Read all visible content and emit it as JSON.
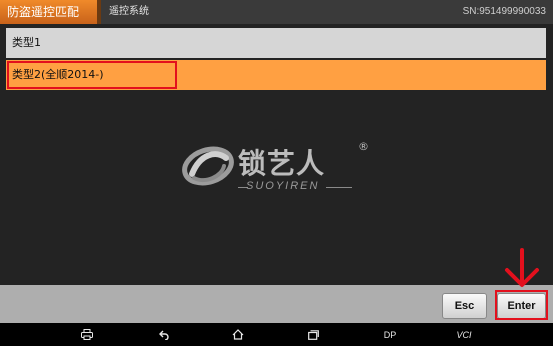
{
  "header": {
    "title": "防盗遥控匹配",
    "subtitle": "遥控系统",
    "serial": "SN:951499990033"
  },
  "list": {
    "items": [
      {
        "label": "类型1",
        "selected": false
      },
      {
        "label": "类型2(全顺2014-)",
        "selected": true
      }
    ]
  },
  "watermark": {
    "brand": "锁艺人",
    "registered": "®",
    "subtext": "SUOYIREN"
  },
  "footer": {
    "esc_label": "Esc",
    "enter_label": "Enter"
  },
  "navbar": {
    "icons": [
      "printer-icon",
      "back-icon",
      "home-icon",
      "recent-apps-icon"
    ],
    "dp_label": "DP",
    "vci_label": "VCI"
  },
  "colors": {
    "accent": "#ffa042",
    "tab": "#f08a2a",
    "annotation": "#e3101d"
  }
}
